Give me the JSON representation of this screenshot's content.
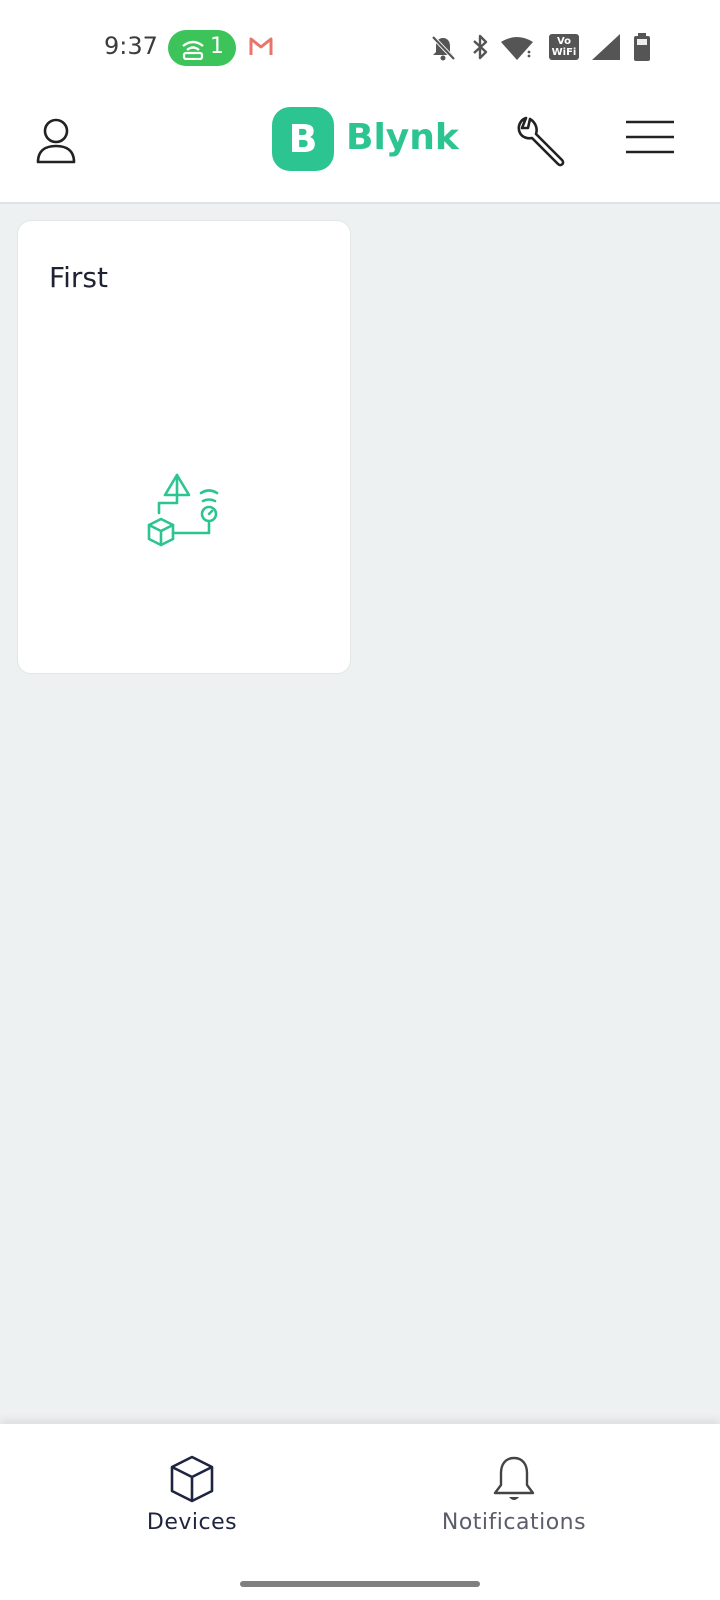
{
  "status_bar": {
    "time": "9:37",
    "hotspot_count": "1",
    "icons": [
      "hotspot-icon",
      "gmail-icon",
      "notifications-off-icon",
      "bluetooth-icon",
      "wifi-icon",
      "vowifi-icon",
      "signal-icon",
      "battery-icon"
    ],
    "vowifi_top": "Vo",
    "vowifi_bottom": "WiFi"
  },
  "header": {
    "logo_letter": "B",
    "logo_text": "Blynk",
    "icons": [
      "profile-icon",
      "wrench-icon",
      "menu-icon"
    ]
  },
  "devices": [
    {
      "name": "First",
      "icon": "device-template-icon"
    }
  ],
  "bottom_nav": {
    "items": [
      {
        "label": "Devices",
        "icon": "cube-icon",
        "active": true
      },
      {
        "label": "Notifications",
        "icon": "bell-icon",
        "active": false
      }
    ]
  },
  "colors": {
    "brand": "#2cc592",
    "hotspot": "#3cc35a",
    "background": "#eef1f1",
    "nav_active": "#1f2540"
  }
}
